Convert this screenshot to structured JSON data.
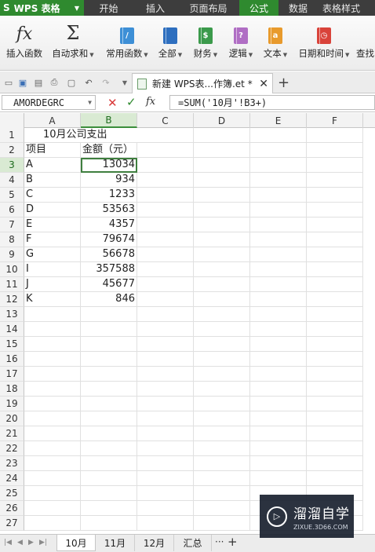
{
  "app": {
    "logo": "S",
    "name": "WPS 表格",
    "accent": "#2f8a2f"
  },
  "menu": {
    "tabs": [
      {
        "label": "开始",
        "active": false
      },
      {
        "label": "插入",
        "active": false
      },
      {
        "label": "页面布局",
        "active": false
      },
      {
        "label": "公式",
        "active": true
      },
      {
        "label": "数据",
        "active": false
      },
      {
        "label": "表格样式",
        "active": false
      }
    ]
  },
  "ribbon": {
    "buttons": [
      {
        "label": "插入函数",
        "icon": "function-icon",
        "dropdown": false
      },
      {
        "label": "自动求和",
        "icon": "sigma-icon",
        "dropdown": true
      },
      {
        "label": "常用函数",
        "icon": "common-functions-icon",
        "dropdown": true,
        "color": "#3d8fd6"
      },
      {
        "label": "全部",
        "icon": "all-functions-icon",
        "dropdown": true,
        "color": "#2e6fbf"
      },
      {
        "label": "财务",
        "icon": "financial-icon",
        "dropdown": true,
        "color": "#3b9a4b",
        "glyph": "$"
      },
      {
        "label": "逻辑",
        "icon": "logical-icon",
        "dropdown": true,
        "color": "#b06ec4",
        "glyph": "?"
      },
      {
        "label": "文本",
        "icon": "text-icon",
        "dropdown": true,
        "color": "#e89a2c",
        "glyph": "a"
      },
      {
        "label": "日期和时间",
        "icon": "date-time-icon",
        "dropdown": true,
        "color": "#d9433a"
      },
      {
        "label": "查找",
        "icon": "lookup-icon",
        "dropdown": false
      }
    ]
  },
  "document": {
    "tab_title": "新建 WPS表...作簿.et *"
  },
  "formula_bar": {
    "name_box": "AMORDEGRC",
    "formula": "=SUM('10月'!B3+)"
  },
  "sheet": {
    "columns": [
      "A",
      "B",
      "C",
      "D",
      "E",
      "F"
    ],
    "selected_column": "B",
    "active_row": 3,
    "row_numbers": [
      "1",
      "2",
      "3",
      "4",
      "5",
      "6",
      "7",
      "8",
      "9",
      "10",
      "11",
      "12",
      "13",
      "14",
      "15",
      "16",
      "17",
      "18",
      "19",
      "20",
      "21",
      "22",
      "23",
      "24",
      "25",
      "26",
      "27"
    ],
    "title": "10月公司支出",
    "headers": {
      "item": "项目",
      "amount": "金额（元）"
    },
    "rows": [
      {
        "item": "A",
        "amount": "13034"
      },
      {
        "item": "B",
        "amount": "934"
      },
      {
        "item": "C",
        "amount": "1233"
      },
      {
        "item": "D",
        "amount": "53563"
      },
      {
        "item": "E",
        "amount": "4357"
      },
      {
        "item": "F",
        "amount": "79674"
      },
      {
        "item": "G",
        "amount": "56678"
      },
      {
        "item": "I",
        "amount": "357588"
      },
      {
        "item": "J",
        "amount": "45677"
      },
      {
        "item": "K",
        "amount": "846"
      }
    ]
  },
  "sheet_tabs": [
    {
      "label": "10月",
      "active": true
    },
    {
      "label": "11月",
      "active": false
    },
    {
      "label": "12月",
      "active": false
    },
    {
      "label": "汇总",
      "active": false
    }
  ],
  "sheet_tab_more": "···",
  "add_sheet": "+",
  "watermark": {
    "title": "溜溜自学",
    "url": "ZIXUE.3D66.COM"
  }
}
